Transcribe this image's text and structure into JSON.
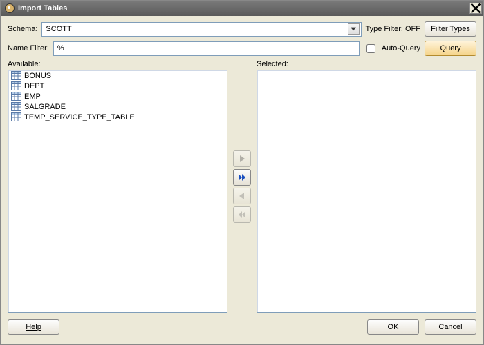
{
  "window": {
    "title": "Import Tables"
  },
  "form": {
    "schemaLabel": "Schema:",
    "schemaValue": "SCOTT",
    "typeFilterLabel": "Type Filter: OFF",
    "filterTypesBtn": "Filter Types",
    "nameFilterLabel": "Name Filter:",
    "nameFilterValue": "%",
    "autoQueryLabel": "Auto-Query",
    "queryBtn": "Query"
  },
  "lists": {
    "availableLabel": "Available:",
    "selectedLabel": "Selected:",
    "available": [
      "BONUS",
      "DEPT",
      "EMP",
      "SALGRADE",
      "TEMP_SERVICE_TYPE_TABLE"
    ]
  },
  "footer": {
    "help": "Help",
    "ok": "OK",
    "cancel": "Cancel"
  }
}
